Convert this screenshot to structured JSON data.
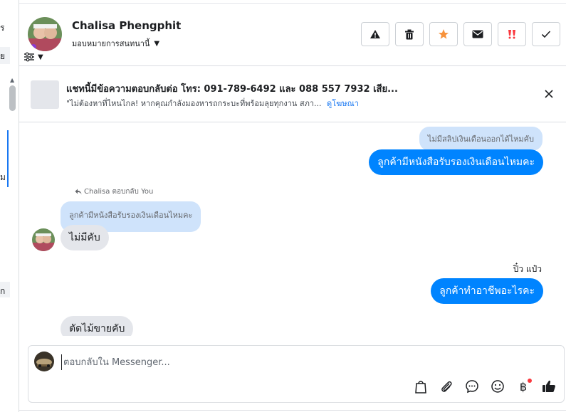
{
  "left_strip": {
    "text1": "ร",
    "text2": "ย",
    "text3": "ม",
    "text4": "ก"
  },
  "header": {
    "name": "Chalisa Phengphit",
    "assign_label": "มอบหมายการสนทนานี้",
    "actions": [
      {
        "icon": "warning-icon",
        "color": "#1c1e21"
      },
      {
        "icon": "trash-icon",
        "color": "#1c1e21"
      },
      {
        "icon": "star-icon",
        "color": "#f7923b"
      },
      {
        "icon": "mail-icon",
        "color": "#1c1e21"
      },
      {
        "icon": "spam-icon",
        "color": "#fa383e"
      },
      {
        "icon": "check-icon",
        "color": "#1c1e21"
      }
    ]
  },
  "ad": {
    "title": "แชทนี้มีข้อความตอบกลับต่อ โทร: 091-789-6492 และ 088 557 7932 เสีย...",
    "subtitle": "\"ไม่ต้องหาที่ไหนไกล! หากคุณกำลังมองหารถกระบะที่พร้อมลุยทุกงาน สภา...",
    "link": "ดูโฆษณา"
  },
  "messages": {
    "quote_out_1": "ไม่มีสลิปเงินเดือนออกได้ไหมคับ",
    "out_1": "ลูกค้ามีหนังสือรับรองเงินเดือนไหมคะ",
    "reply_meta": "Chalisa ตอบกลับ You",
    "quote_in_1": "ลูกค้ามีหนังสือรับรองเงินเดือนไหมคะ",
    "in_1": "ไม่มีคับ",
    "sender_out_2": "ปิ๋ว แป๋ว",
    "out_2": "ลูกค้าทำอาชีพอะไรคะ",
    "in_2": "ตัดไม้ขายคับ"
  },
  "composer": {
    "placeholder": "ตอบกลับใน Messenger..."
  },
  "colors": {
    "accent": "#0084ff",
    "link": "#1877f2",
    "quote_bg": "#cfe3fb",
    "incoming_bg": "#e4e6eb"
  }
}
